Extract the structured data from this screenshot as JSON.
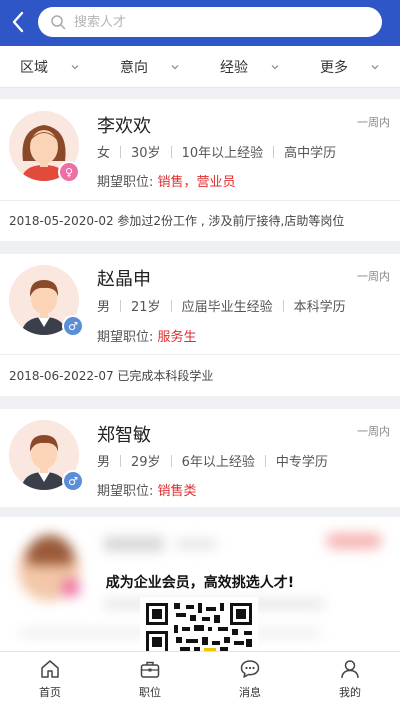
{
  "search": {
    "placeholder": "搜索人才"
  },
  "filters": [
    {
      "label": "区域"
    },
    {
      "label": "意向"
    },
    {
      "label": "经验"
    },
    {
      "label": "更多"
    }
  ],
  "candidates": [
    {
      "name": "李欢欢",
      "time": "一周内",
      "gender": "女",
      "age": "30岁",
      "experience": "10年以上经验",
      "education": "高中学历",
      "expect_label": "期望职位:",
      "expect_value": "销售，营业员",
      "history": "2018-05-2020-02 参加过2份工作 , 涉及前厅接待,店助等岗位"
    },
    {
      "name": "赵晶申",
      "time": "一周内",
      "gender": "男",
      "age": "21岁",
      "experience": "应届毕业生经验",
      "education": "本科学历",
      "expect_label": "期望职位:",
      "expect_value": "服务生",
      "history": "2018-06-2022-07 已完成本科段学业"
    },
    {
      "name": "郑智敏",
      "time": "一周内",
      "gender": "男",
      "age": "29岁",
      "experience": "6年以上经验",
      "education": "中专学历",
      "expect_label": "期望职位:",
      "expect_value": "销售类"
    }
  ],
  "promo": {
    "text": "成为企业会员，高效挑选人才!"
  },
  "tabs": [
    {
      "label": "首页",
      "icon": "home-icon"
    },
    {
      "label": "职位",
      "icon": "briefcase-icon"
    },
    {
      "label": "消息",
      "icon": "message-icon"
    },
    {
      "label": "我的",
      "icon": "user-icon"
    }
  ],
  "colors": {
    "brand": "#2f56c7",
    "accent_red": "#e02e2e",
    "female": "#ee6fa5",
    "male": "#5a8fd8"
  }
}
